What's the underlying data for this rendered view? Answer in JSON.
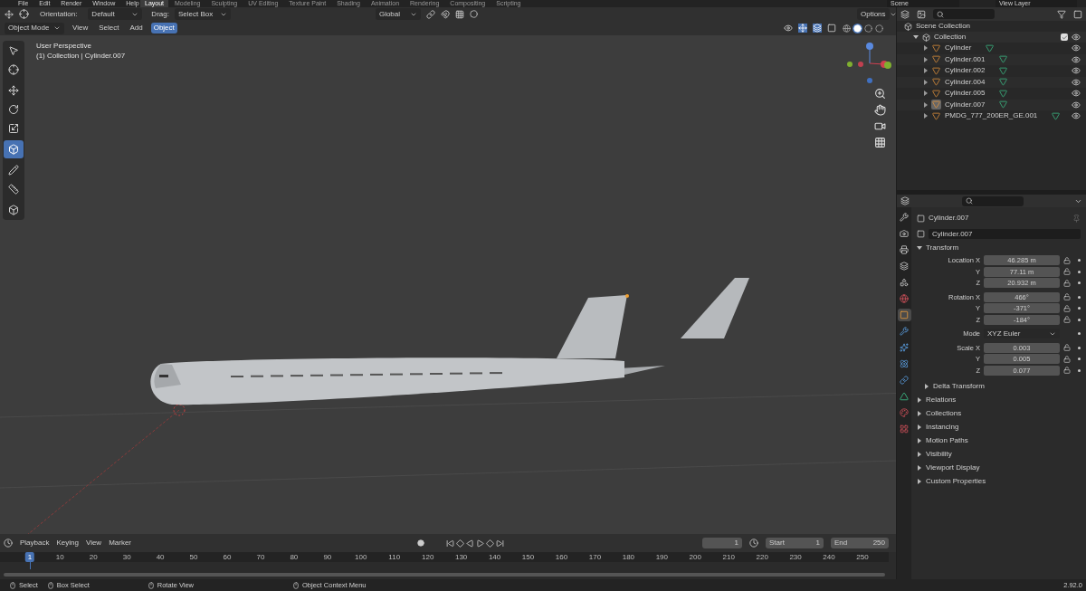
{
  "top_bar": {
    "menus": [
      "File",
      "Edit",
      "Render",
      "Window",
      "Help"
    ],
    "workspace_tabs": [
      {
        "label": "Layout",
        "selected": true
      },
      {
        "label": "Modeling",
        "selected": false
      },
      {
        "label": "Sculpting",
        "selected": false
      },
      {
        "label": "UV Editing",
        "selected": false
      },
      {
        "label": "Texture Paint",
        "selected": false
      },
      {
        "label": "Shading",
        "selected": false
      },
      {
        "label": "Animation",
        "selected": false
      },
      {
        "label": "Rendering",
        "selected": false
      },
      {
        "label": "Compositing",
        "selected": false
      },
      {
        "label": "Scripting",
        "selected": false
      }
    ],
    "scene": "Scene",
    "view_layer": "View Layer"
  },
  "viewport_header": {
    "orientation_label": "Orientation:",
    "orientation": "Default",
    "drag_label": "Drag:",
    "drag": "Select Box",
    "transform_orientation": "Global",
    "options": "Options",
    "mode": "Object Mode",
    "menus": [
      {
        "label": "View",
        "selected": false
      },
      {
        "label": "Select",
        "selected": false
      },
      {
        "label": "Add",
        "selected": false
      },
      {
        "label": "Object",
        "selected": true
      }
    ],
    "shading_modes": [
      {
        "kind": "wireframe",
        "selected": false
      },
      {
        "kind": "solid",
        "selected": true
      },
      {
        "kind": "material",
        "selected": false
      },
      {
        "kind": "rendered",
        "selected": false
      }
    ]
  },
  "toolbar": [
    {
      "kind": "select",
      "selected": false
    },
    {
      "kind": "cursor",
      "selected": false
    },
    {
      "kind": "move",
      "selected": false
    },
    {
      "kind": "rotate",
      "selected": false
    },
    {
      "kind": "scale",
      "selected": false
    },
    {
      "kind": "transform",
      "selected": true
    },
    {
      "kind": "annotate",
      "selected": false
    },
    {
      "kind": "measure",
      "selected": false
    },
    {
      "kind": "add_cube",
      "selected": false
    }
  ],
  "viewport": {
    "view_name": "User Perspective",
    "context": "(1) Collection | Cylinder.007"
  },
  "outliner": {
    "root": "Scene Collection",
    "collections": [
      {
        "name": "Collection",
        "expanded": true,
        "checked": true,
        "children": [
          {
            "name": "Cylinder",
            "selected": false
          },
          {
            "name": "Cylinder.001",
            "selected": false
          },
          {
            "name": "Cylinder.002",
            "selected": false
          },
          {
            "name": "Cylinder.004",
            "selected": false
          },
          {
            "name": "Cylinder.005",
            "selected": false
          },
          {
            "name": "Cylinder.007",
            "selected": true
          },
          {
            "name": "PMDG_777_200ER_GE.001",
            "selected": false
          }
        ]
      }
    ]
  },
  "properties": {
    "tabs": [
      {
        "kind": "tool",
        "selected": false
      },
      {
        "kind": "render",
        "selected": false
      },
      {
        "kind": "output",
        "selected": false
      },
      {
        "kind": "view_layer",
        "selected": false
      },
      {
        "kind": "scene",
        "selected": false
      },
      {
        "kind": "world",
        "selected": false
      },
      {
        "kind": "object",
        "selected": true
      },
      {
        "kind": "modifier",
        "selected": false
      },
      {
        "kind": "particles",
        "selected": false
      },
      {
        "kind": "physics",
        "selected": false
      },
      {
        "kind": "constraints",
        "selected": false
      },
      {
        "kind": "data",
        "selected": false
      },
      {
        "kind": "material",
        "selected": false
      },
      {
        "kind": "texture",
        "selected": false
      }
    ],
    "object_name": "Cylinder.007",
    "datablock": "Cylinder.007",
    "transform": {
      "title": "Transform",
      "expanded": true,
      "groups": [
        {
          "rows": [
            {
              "label": "Location X",
              "value": "46.285 m",
              "kind": "number"
            },
            {
              "label": "Y",
              "value": "77.11 m",
              "kind": "number"
            },
            {
              "label": "Z",
              "value": "20.932 m",
              "kind": "number"
            }
          ]
        },
        {
          "rows": [
            {
              "label": "Rotation X",
              "value": "466°",
              "kind": "number"
            },
            {
              "label": "Y",
              "value": "-371°",
              "kind": "number"
            },
            {
              "label": "Z",
              "value": "-184°",
              "kind": "number"
            }
          ]
        },
        {
          "rows": [
            {
              "label": "Mode",
              "value": "XYZ Euler",
              "kind": "dropdown"
            }
          ]
        },
        {
          "rows": [
            {
              "label": "Scale X",
              "value": "0.003",
              "kind": "number"
            },
            {
              "label": "Y",
              "value": "0.005",
              "kind": "number"
            },
            {
              "label": "Z",
              "value": "0.077",
              "kind": "number"
            }
          ]
        }
      ],
      "subpanel": {
        "title": "Delta Transform",
        "expanded": false
      }
    },
    "panels": [
      {
        "title": "Relations",
        "expanded": false
      },
      {
        "title": "Collections",
        "expanded": false
      },
      {
        "title": "Instancing",
        "expanded": false
      },
      {
        "title": "Motion Paths",
        "expanded": false
      },
      {
        "title": "Visibility",
        "expanded": false
      },
      {
        "title": "Viewport Display",
        "expanded": false
      },
      {
        "title": "Custom Properties",
        "expanded": false
      }
    ]
  },
  "timeline": {
    "menus": [
      "Playback",
      "Keying",
      "View",
      "Marker"
    ],
    "current_frame": "1",
    "start_label": "Start",
    "start": "1",
    "end_label": "End",
    "end": "250",
    "playhead": "1",
    "ticks": [
      "10",
      "20",
      "30",
      "40",
      "50",
      "60",
      "70",
      "80",
      "90",
      "100",
      "110",
      "120",
      "130",
      "140",
      "150",
      "160",
      "170",
      "180",
      "190",
      "200",
      "210",
      "220",
      "230",
      "240",
      "250"
    ]
  },
  "status_bar": {
    "hints": [
      "Select",
      "Box Select",
      "Rotate View",
      "Object Context Menu"
    ],
    "version": "2.92.0"
  }
}
